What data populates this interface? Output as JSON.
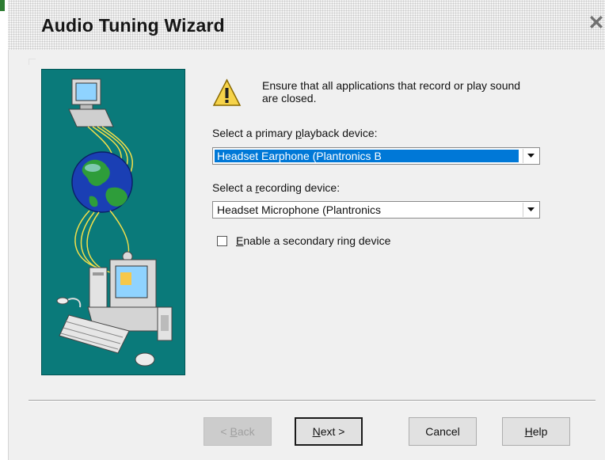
{
  "window": {
    "title": "Audio Tuning Wizard",
    "close_glyph": "✕"
  },
  "warning": {
    "icon": "warning-icon",
    "text": "Ensure that all applications that record or play sound are closed."
  },
  "playback": {
    "label_before": "Select a primary ",
    "label_accel": "p",
    "label_after": "layback device:",
    "value": "Headset Earphone (Plantronics B"
  },
  "recording": {
    "label_before": "Select a ",
    "label_accel": "r",
    "label_after": "ecording device:",
    "value": "Headset Microphone (Plantronics"
  },
  "ring_device": {
    "label_accel": "E",
    "label_after": "nable a secondary ring device",
    "checked": false
  },
  "buttons": {
    "back_prefix": "< ",
    "back_accel": "B",
    "back_after": "ack",
    "next_accel": "N",
    "next_after": "ext >",
    "cancel": "Cancel",
    "help_accel": "H",
    "help_after": "elp"
  },
  "colors": {
    "illustration_bg": "#0a7a7a",
    "selection": "#0078d7"
  }
}
